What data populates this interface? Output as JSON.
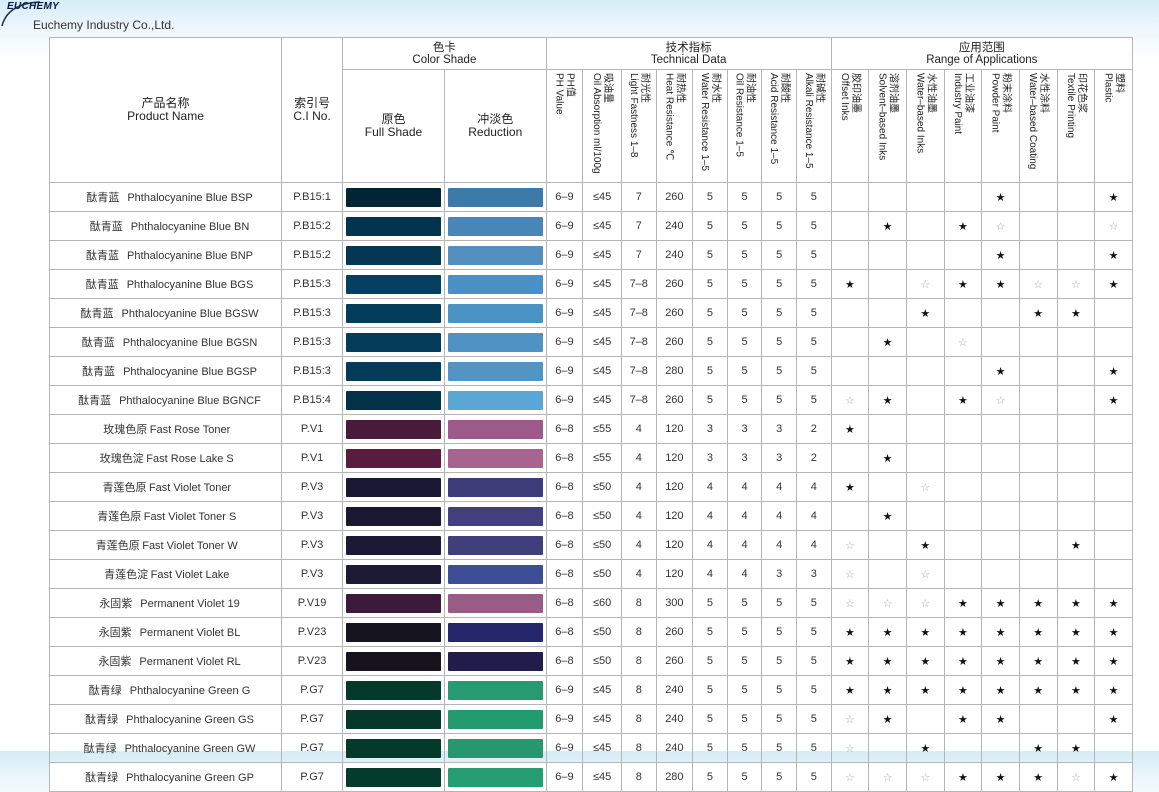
{
  "header": {
    "logo_text": "EUCHEMY",
    "company": "Euchemy Industry Co.,Ltd."
  },
  "columns": {
    "product_zh": "产品名称",
    "product_en": "Product Name",
    "ci_zh": "索引号",
    "ci_en": "C.I No.",
    "color_group_zh": "色卡",
    "color_group_en": "Color Shade",
    "full_zh": "原色",
    "full_en": "Full Shade",
    "red_zh": "冲淡色",
    "red_en": "Reduction",
    "tech_group_zh": "技术指标",
    "tech_group_en": "Technical Data",
    "app_group_zh": "应用范围",
    "app_group_en": "Range of Applications",
    "tech": [
      {
        "zh": "PH值",
        "en": "PH Value"
      },
      {
        "zh": "吸油量",
        "en": "Oil Absorption ml/100g"
      },
      {
        "zh": "耐光性",
        "en": "Light Fastness 1–8"
      },
      {
        "zh": "耐热性",
        "en": "Heat Resistance ℃"
      },
      {
        "zh": "耐水性",
        "en": "Water Resistance 1–5"
      },
      {
        "zh": "耐油性",
        "en": "Oil Resistance 1–5"
      },
      {
        "zh": "耐酸性",
        "en": "Acid Resistance 1–5"
      },
      {
        "zh": "耐碱性",
        "en": "Alkali Resistance 1–5"
      }
    ],
    "apps": [
      {
        "zh": "胶印油墨",
        "en": "Offset Inks"
      },
      {
        "zh": "溶剂油墨",
        "en": "Solvent–based Inks"
      },
      {
        "zh": "水性油墨",
        "en": "Water–based Inks"
      },
      {
        "zh": "工业油漆",
        "en": "Industry Paint"
      },
      {
        "zh": "粉末涂料",
        "en": "Powder Paint"
      },
      {
        "zh": "水性涂料",
        "en": "Water–based Coating"
      },
      {
        "zh": "印花色浆",
        "en": "Textile Printing"
      },
      {
        "zh": "塑料",
        "en": "Plastic"
      }
    ]
  },
  "rows": [
    {
      "zh": "酞青蓝",
      "en": "Phthalocyanine Blue BSP",
      "ci": "P.B15:1",
      "full": "#022536",
      "red": "#3e7aa8",
      "tech": [
        "6–9",
        "≤45",
        "7",
        "260",
        "5",
        "5",
        "5",
        "5"
      ],
      "apps": [
        "",
        "",
        "",
        "",
        "★",
        "",
        "",
        "★"
      ]
    },
    {
      "zh": "酞青蓝",
      "en": "Phthalocyanine Blue BN",
      "ci": "P.B15:2",
      "full": "#02344e",
      "red": "#4886b8",
      "tech": [
        "6–9",
        "≤45",
        "7",
        "240",
        "5",
        "5",
        "5",
        "5"
      ],
      "apps": [
        "",
        "★",
        "",
        "★",
        "☆",
        "",
        "",
        "☆"
      ]
    },
    {
      "zh": "酞青蓝",
      "en": "Phthalocyanine Blue BNP",
      "ci": "P.B15:2",
      "full": "#033753",
      "red": "#538fbf",
      "tech": [
        "6–9",
        "≤45",
        "7",
        "240",
        "5",
        "5",
        "5",
        "5"
      ],
      "apps": [
        "",
        "",
        "",
        "",
        "★",
        "",
        "",
        "★"
      ]
    },
    {
      "zh": "酞青蓝",
      "en": "Phthalocyanine Blue BGS",
      "ci": "P.B15:3",
      "full": "#033f5e",
      "red": "#4a92c6",
      "tech": [
        "6–9",
        "≤45",
        "7–8",
        "260",
        "5",
        "5",
        "5",
        "5"
      ],
      "apps": [
        "★",
        "",
        "☆",
        "★",
        "★",
        "☆",
        "☆",
        "★"
      ]
    },
    {
      "zh": "酞青蓝",
      "en": "Phthalocyanine Blue BGSW",
      "ci": "P.B15:3",
      "full": "#033d5b",
      "red": "#4b92c5",
      "tech": [
        "6–9",
        "≤45",
        "7–8",
        "260",
        "5",
        "5",
        "5",
        "5"
      ],
      "apps": [
        "",
        "",
        "★",
        "",
        "",
        "★",
        "★",
        ""
      ]
    },
    {
      "zh": "酞青蓝",
      "en": "Phthalocyanine Blue BGSN",
      "ci": "P.B15:3",
      "full": "#043c59",
      "red": "#4f92c3",
      "tech": [
        "6–9",
        "≤45",
        "7–8",
        "260",
        "5",
        "5",
        "5",
        "5"
      ],
      "apps": [
        "",
        "★",
        "",
        "☆",
        "",
        "",
        "",
        ""
      ]
    },
    {
      "zh": "酞青蓝",
      "en": "Phthalocyanine Blue BGSP",
      "ci": "P.B15:3",
      "full": "#043b58",
      "red": "#5294c4",
      "tech": [
        "6–9",
        "≤45",
        "7–8",
        "280",
        "5",
        "5",
        "5",
        "5"
      ],
      "apps": [
        "",
        "",
        "",
        "",
        "★",
        "",
        "",
        "★"
      ]
    },
    {
      "zh": "酞青蓝",
      "en": "Phthalocyanine Blue BGNCF",
      "ci": "P.B15:4",
      "full": "#023247",
      "red": "#5aa7d6",
      "tech": [
        "6–9",
        "≤45",
        "7–8",
        "260",
        "5",
        "5",
        "5",
        "5"
      ],
      "apps": [
        "☆",
        "★",
        "",
        "★",
        "☆",
        "",
        "",
        "★"
      ]
    },
    {
      "zh": "玫瑰色原",
      "en": "Fast Rose Toner",
      "ci": "P.V1",
      "full": "#4a1a3a",
      "red": "#9c5a8c",
      "tech": [
        "6–8",
        "≤55",
        "4",
        "120",
        "3",
        "3",
        "3",
        "2"
      ],
      "apps": [
        "★",
        "",
        "",
        "",
        "",
        "",
        "",
        ""
      ]
    },
    {
      "zh": "玫瑰色淀",
      "en": "Fast Rose Lake S",
      "ci": "P.V1",
      "full": "#5a1c3e",
      "red": "#a86491",
      "tech": [
        "6–8",
        "≤55",
        "4",
        "120",
        "3",
        "3",
        "3",
        "2"
      ],
      "apps": [
        "",
        "★",
        "",
        "",
        "",
        "",
        "",
        ""
      ]
    },
    {
      "zh": "青莲色原",
      "en": "Fast Violet Toner",
      "ci": "P.V3",
      "full": "#1b1833",
      "red": "#3e3c78",
      "tech": [
        "6–8",
        "≤50",
        "4",
        "120",
        "4",
        "4",
        "4",
        "4"
      ],
      "apps": [
        "★",
        "",
        "☆",
        "",
        "",
        "",
        "",
        ""
      ]
    },
    {
      "zh": "青莲色原",
      "en": "Fast Violet Toner S",
      "ci": "P.V3",
      "full": "#1a1731",
      "red": "#423f7c",
      "tech": [
        "6–8",
        "≤50",
        "4",
        "120",
        "4",
        "4",
        "4",
        "4"
      ],
      "apps": [
        "",
        "★",
        "",
        "",
        "",
        "",
        "",
        ""
      ]
    },
    {
      "zh": "青莲色原",
      "en": "Fast Violet Toner W",
      "ci": "P.V3",
      "full": "#1c1934",
      "red": "#403e7b",
      "tech": [
        "6–8",
        "≤50",
        "4",
        "120",
        "4",
        "4",
        "4",
        "4"
      ],
      "apps": [
        "☆",
        "",
        "★",
        "",
        "",
        "",
        "★",
        ""
      ]
    },
    {
      "zh": "青莲色淀",
      "en": "Fast Violet Lake",
      "ci": "P.V3",
      "full": "#1d1a36",
      "red": "#3d4d96",
      "tech": [
        "6–8",
        "≤50",
        "4",
        "120",
        "4",
        "4",
        "3",
        "3"
      ],
      "apps": [
        "☆",
        "",
        "☆",
        "",
        "",
        "",
        "",
        ""
      ]
    },
    {
      "zh": "永固紫",
      "en": "Permanent Violet 19",
      "ci": "P.V19",
      "full": "#3c1a3c",
      "red": "#9a5c86",
      "tech": [
        "6–8",
        "≤60",
        "8",
        "300",
        "5",
        "5",
        "5",
        "5"
      ],
      "apps": [
        "☆",
        "☆",
        "☆",
        "★",
        "★",
        "★",
        "★",
        "★"
      ]
    },
    {
      "zh": "永固紫",
      "en": "Permanent Violet BL",
      "ci": "P.V23",
      "full": "#16141f",
      "red": "#26276a",
      "tech": [
        "6–8",
        "≤50",
        "8",
        "260",
        "5",
        "5",
        "5",
        "5"
      ],
      "apps": [
        "★",
        "★",
        "★",
        "★",
        "★",
        "★",
        "★",
        "★"
      ]
    },
    {
      "zh": "永固紫",
      "en": "Permanent Violet RL",
      "ci": "P.V23",
      "full": "#17131d",
      "red": "#221c4c",
      "tech": [
        "6–8",
        "≤50",
        "8",
        "260",
        "5",
        "5",
        "5",
        "5"
      ],
      "apps": [
        "★",
        "★",
        "★",
        "★",
        "★",
        "★",
        "★",
        "★"
      ]
    },
    {
      "zh": "酞青绿",
      "en": "Phthalocyanine Green G",
      "ci": "P.G7",
      "full": "#033a2a",
      "red": "#279a72",
      "tech": [
        "6–9",
        "≤45",
        "8",
        "240",
        "5",
        "5",
        "5",
        "5"
      ],
      "apps": [
        "★",
        "★",
        "★",
        "★",
        "★",
        "★",
        "★",
        "★"
      ]
    },
    {
      "zh": "酞青绿",
      "en": "Phthalocyanine Green GS",
      "ci": "P.G7",
      "full": "#043828",
      "red": "#249a70",
      "tech": [
        "6–9",
        "≤45",
        "8",
        "240",
        "5",
        "5",
        "5",
        "5"
      ],
      "apps": [
        "☆",
        "★",
        "",
        "★",
        "★",
        "",
        "",
        "★"
      ]
    },
    {
      "zh": "酞青绿",
      "en": "Phthalocyanine Green GW",
      "ci": "P.G7",
      "full": "#053a2b",
      "red": "#26986f",
      "tech": [
        "6–9",
        "≤45",
        "8",
        "240",
        "5",
        "5",
        "5",
        "5"
      ],
      "apps": [
        "☆",
        "",
        "★",
        "",
        "",
        "★",
        "★",
        ""
      ]
    },
    {
      "zh": "酞青绿",
      "en": "Phthalocyanine Green GP",
      "ci": "P.G7",
      "full": "#043b2b",
      "red": "#279d73",
      "tech": [
        "6–9",
        "≤45",
        "8",
        "280",
        "5",
        "5",
        "5",
        "5"
      ],
      "apps": [
        "☆",
        "☆",
        "☆",
        "★",
        "★",
        "★",
        "☆",
        "★"
      ]
    }
  ]
}
